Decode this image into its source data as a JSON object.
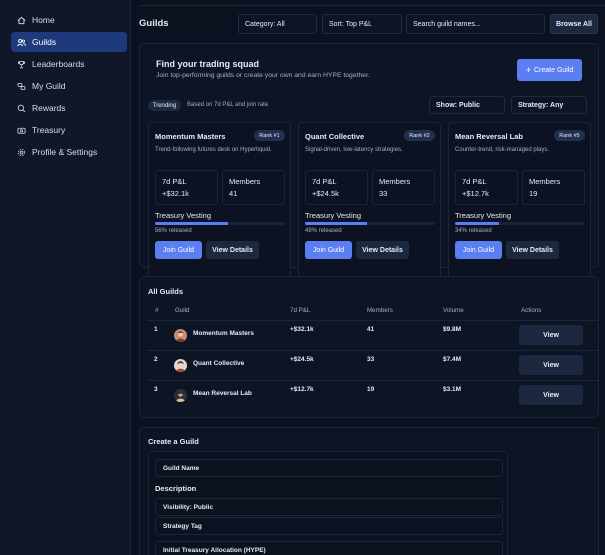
{
  "sidebar": {
    "items": [
      {
        "label": "Home",
        "icon": "home-icon"
      },
      {
        "label": "Guilds",
        "icon": "users-icon",
        "active": true
      },
      {
        "label": "Leaderboards",
        "icon": "trophy-icon"
      },
      {
        "label": "My Guild",
        "icon": "link-icon"
      },
      {
        "label": "Rewards",
        "icon": "gift-icon"
      },
      {
        "label": "Treasury",
        "icon": "wallet-icon"
      },
      {
        "label": "Profile & Settings",
        "icon": "gear-icon"
      }
    ]
  },
  "header": {
    "title": "Guilds",
    "category": "Category: All",
    "sort": "Sort: Top P&L",
    "search_placeholder": "Search guild names...",
    "browse_label": "Browse All"
  },
  "hero": {
    "title": "Find your trading squad",
    "subtitle": "Join top-performing guilds or create your own and earn HYPE together.",
    "create_label": "Create Guild",
    "trending_badge": "Trending",
    "trending_note": "Based on 7d P&L and join rate",
    "visibility": "Show: Public",
    "strategy": "Strategy: Any"
  },
  "cards": [
    {
      "name": "Momentum Masters",
      "rank": "Rank #1",
      "desc": "Trend-following futures desk on Hyperliquid.",
      "pnl_label": "7d P&L",
      "pnl": "+$32.1k",
      "members_label": "Members",
      "members": "41",
      "vesting_label": "Treasury Vesting",
      "vesting_pct": 56,
      "vesting_text": "56% released",
      "join_label": "Join Guild",
      "details_label": "View Details"
    },
    {
      "name": "Quant Collective",
      "rank": "Rank #2",
      "desc": "Signal-driven, low-latency strategies.",
      "pnl_label": "7d P&L",
      "pnl": "+$24.5k",
      "members_label": "Members",
      "members": "33",
      "vesting_label": "Treasury Vesting",
      "vesting_pct": 48,
      "vesting_text": "48% released",
      "join_label": "Join Guild",
      "details_label": "View Details"
    },
    {
      "name": "Mean Reversal Lab",
      "rank": "Rank #5",
      "desc": "Counter-trend, risk-managed plays.",
      "pnl_label": "7d P&L",
      "pnl": "+$12.7k",
      "members_label": "Members",
      "members": "19",
      "vesting_label": "Treasury Vesting",
      "vesting_pct": 34,
      "vesting_text": "34% released",
      "join_label": "Join Guild",
      "details_label": "View Details"
    }
  ],
  "table": {
    "title": "All Guilds",
    "headers": [
      "#",
      "Guild",
      "7d P&L",
      "Members",
      "Volume",
      "Actions"
    ],
    "rows": [
      {
        "rank": "1",
        "guild": "Momentum Masters",
        "pnl": "+$32.1k",
        "members": "41",
        "volume": "$9.8M",
        "action": "View"
      },
      {
        "rank": "2",
        "guild": "Quant Collective",
        "pnl": "+$24.5k",
        "members": "33",
        "volume": "$7.4M",
        "action": "View"
      },
      {
        "rank": "3",
        "guild": "Mean Reversal Lab",
        "pnl": "+$12.7k",
        "members": "19",
        "volume": "$3.1M",
        "action": "View"
      }
    ]
  },
  "create": {
    "title": "Create a Guild",
    "name_placeholder": "Guild Name",
    "description_label": "Description",
    "visibility": "Visibility: Public",
    "strategy_tag": "Strategy Tag",
    "treasury": "Initial Treasury Allocation (HYPE)"
  },
  "colors": {
    "accent": "#5b7ff2",
    "sidebar_active": "#1e3a7a",
    "background": "#0b111f"
  }
}
